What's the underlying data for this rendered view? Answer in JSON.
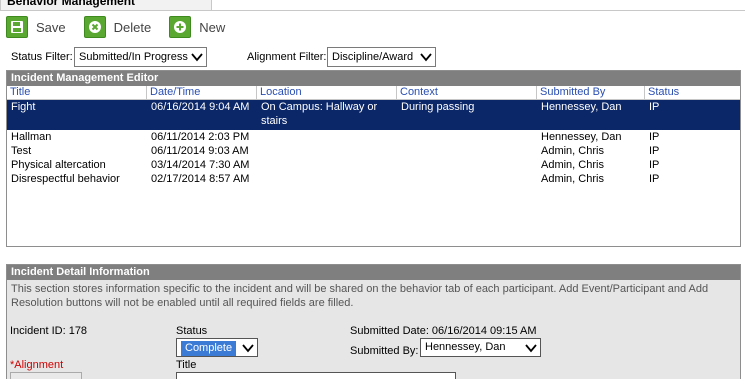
{
  "tab": {
    "title": "Behavior Management"
  },
  "toolbar": {
    "save_label": "Save",
    "delete_label": "Delete",
    "new_label": "New"
  },
  "filters": {
    "status_label": "Status Filter:",
    "status_value": "Submitted/In Progress",
    "alignment_label": "Alignment Filter:",
    "alignment_value": "Discipline/Award"
  },
  "editor": {
    "title": "Incident Management Editor",
    "columns": [
      "Title",
      "Date/Time",
      "Location",
      "Context",
      "Submitted By",
      "Status"
    ],
    "rows": [
      {
        "title": "Fight",
        "datetime": "06/16/2014 9:04 AM",
        "location": "On Campus: Hallway or stairs",
        "context": "During passing",
        "submitted_by": "Hennessey, Dan",
        "status": "IP"
      },
      {
        "title": "Hallman",
        "datetime": "06/11/2014 2:03 PM",
        "location": "",
        "context": "",
        "submitted_by": "Hennessey, Dan",
        "status": "IP"
      },
      {
        "title": "Test",
        "datetime": "06/11/2014 9:03 AM",
        "location": "",
        "context": "",
        "submitted_by": "Admin, Chris",
        "status": "IP"
      },
      {
        "title": "Physical altercation",
        "datetime": "03/14/2014 7:30 AM",
        "location": "",
        "context": "",
        "submitted_by": "Admin, Chris",
        "status": "IP"
      },
      {
        "title": "Disrespectful behavior",
        "datetime": "02/17/2014 8:57 AM",
        "location": "",
        "context": "",
        "submitted_by": "Admin, Chris",
        "status": "IP"
      }
    ]
  },
  "detail": {
    "title": "Incident Detail Information",
    "description": "This section stores information specific to the incident and will be shared on the behavior tab of each participant. Add Event/Participant and Add Resolution buttons will not be enabled until all required fields are filled.",
    "incident_id_label": "Incident ID: 178",
    "status_label": "Status",
    "status_value": "Complete",
    "submitted_date_label": "Submitted Date: 06/16/2014 09:15 AM",
    "submitted_by_label": "Submitted By:",
    "submitted_by_value": "Hennessey, Dan",
    "alignment_label": "Alignment",
    "alignment_required_mark": "*",
    "title_label": "Title"
  },
  "colors": {
    "selected_row": "#0b2768",
    "header_gray": "#7f7f7f",
    "link_blue": "#2a4fb3",
    "button_green": "#5aa832"
  }
}
